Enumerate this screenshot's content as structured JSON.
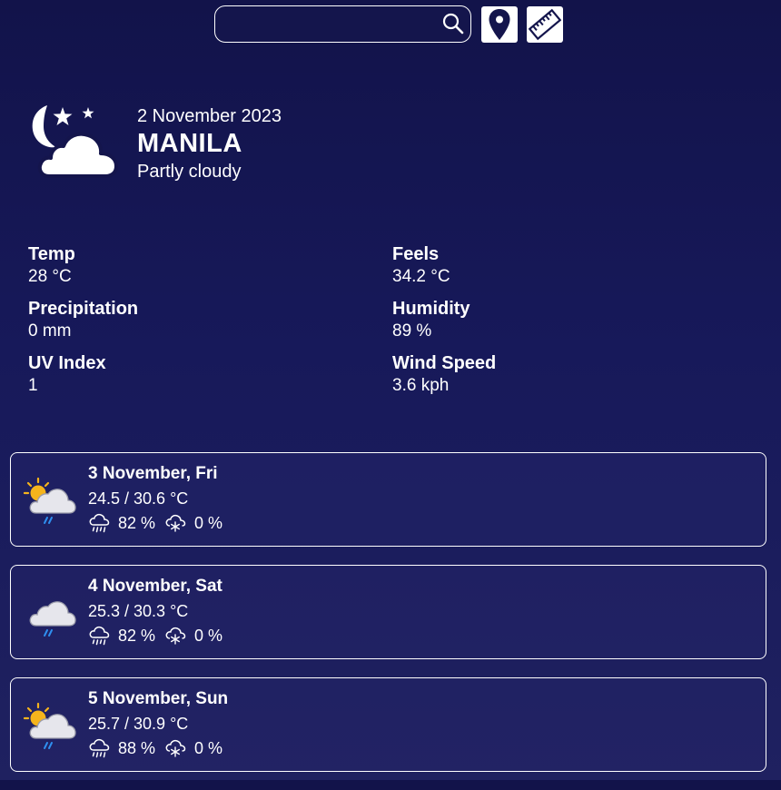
{
  "search": {
    "placeholder": "",
    "value": ""
  },
  "toolbar": {
    "location_icon": "location-pin-icon",
    "units_icon": "ruler-icon"
  },
  "current": {
    "icon": "night-partly-cloudy-icon",
    "date": "2 November 2023",
    "city": "MANILA",
    "condition": "Partly cloudy"
  },
  "stats": {
    "temp": {
      "label": "Temp",
      "value": "28 °C"
    },
    "feels": {
      "label": "Feels",
      "value": "34.2 °C"
    },
    "precipitation": {
      "label": "Precipitation",
      "value": "0 mm"
    },
    "humidity": {
      "label": "Humidity",
      "value": "89 %"
    },
    "uv": {
      "label": "UV Index",
      "value": "1"
    },
    "wind": {
      "label": "Wind Speed",
      "value": "3.6 kph"
    }
  },
  "forecast": [
    {
      "icon": "sun-cloud-rain-icon",
      "date": "3 November, Fri",
      "temp": "24.5 / 30.6 °C",
      "rain_chance": "82 %",
      "snow_chance": "0 %"
    },
    {
      "icon": "cloud-rain-icon",
      "date": "4 November, Sat",
      "temp": "25.3 / 30.3 °C",
      "rain_chance": "82 %",
      "snow_chance": "0 %"
    },
    {
      "icon": "sun-cloud-rain-icon",
      "date": "5 November, Sun",
      "temp": "25.7 / 30.9 °C",
      "rain_chance": "88 %",
      "snow_chance": "0 %"
    }
  ],
  "colors": {
    "background": "#14154c",
    "text": "#ffffff",
    "sun": "#f5b41c",
    "rain": "#2f8ff0",
    "cloud": "#e8e8ee"
  }
}
